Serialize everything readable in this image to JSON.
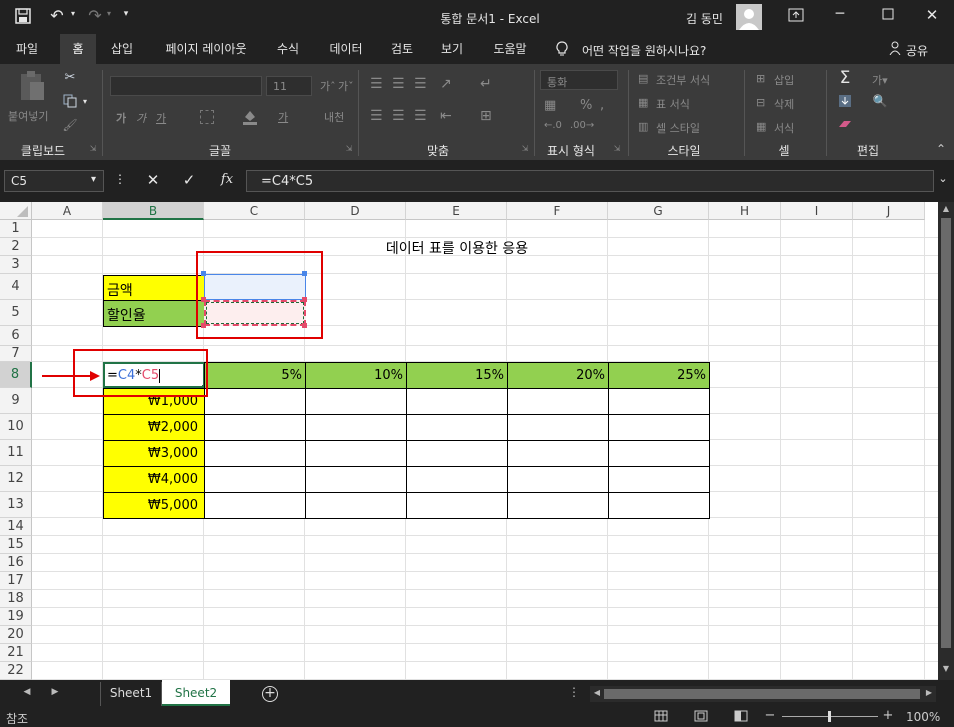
{
  "titlebar": {
    "title": "통합 문서1  -  Excel",
    "user": "김 동민"
  },
  "tabs": [
    "파일",
    "홈",
    "삽입",
    "페이지 레이아웃",
    "수식",
    "데이터",
    "검토",
    "보기",
    "도움말"
  ],
  "tell_me": "어떤 작업을 원하시나요?",
  "share": "공유",
  "ribbon": {
    "groups": [
      "클립보드",
      "글꼴",
      "맞춤",
      "표시 형식",
      "스타일",
      "셀",
      "편집"
    ],
    "paste": "붙여넣기",
    "font_size": "11",
    "number_format": "통화",
    "conditional": "조건부 서식",
    "table_format": "표 서식",
    "cell_style": "셀 스타일",
    "insert": "삽입",
    "delete": "삭제",
    "format": "서식",
    "percent": "%"
  },
  "formula_bar": {
    "name_box": "C5",
    "formula": "=C4*C5",
    "fx": "fx"
  },
  "columns": [
    "A",
    "B",
    "C",
    "D",
    "E",
    "F",
    "G",
    "H",
    "I",
    "J"
  ],
  "rows": [
    "1",
    "2",
    "3",
    "4",
    "5",
    "6",
    "7",
    "8",
    "9",
    "10",
    "11",
    "12",
    "13",
    "14",
    "15",
    "16",
    "17",
    "18",
    "19",
    "20",
    "21",
    "22"
  ],
  "cells": {
    "title": "데이터 표를 이용한 응용",
    "b4": "금액",
    "b5": "할인율",
    "b8_prefix": "=",
    "b8_ref1": "C4",
    "b8_op": "*",
    "b8_ref2": "C5",
    "row8": [
      "5%",
      "10%",
      "15%",
      "20%",
      "25%"
    ],
    "amounts": [
      "₩1,000",
      "₩2,000",
      "₩3,000",
      "₩4,000",
      "₩5,000"
    ]
  },
  "sheet_tabs": [
    "Sheet1",
    "Sheet2"
  ],
  "status": {
    "mode": "참조",
    "zoom": "100%"
  },
  "colors": {
    "yellow": "#ffff00",
    "green": "#92d050",
    "annotation_red": "#e00000",
    "active_tab": "#217346"
  }
}
